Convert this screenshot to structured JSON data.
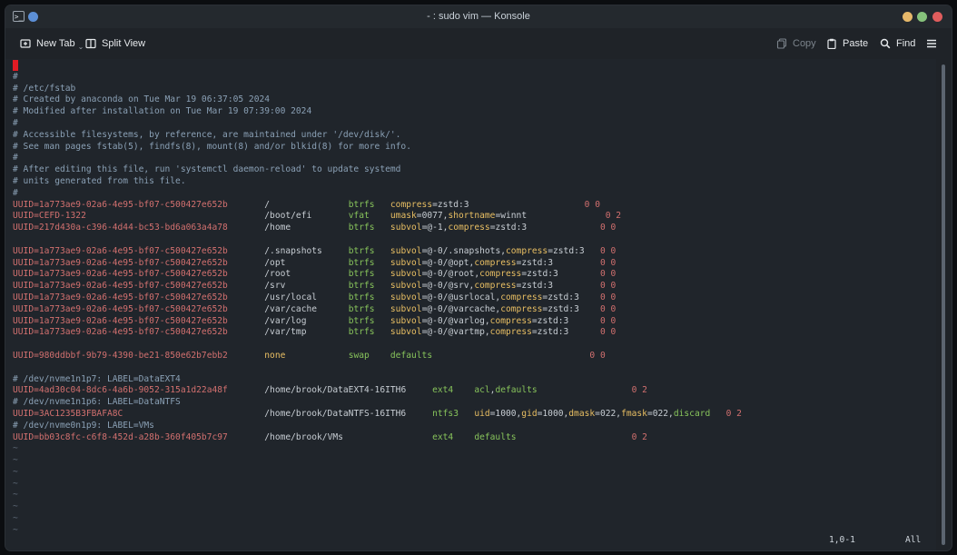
{
  "window": {
    "title": "- : sudo vim — Konsole",
    "app_icon": "terminal-icon",
    "controls": [
      "minimize-icon",
      "maximize-icon",
      "close-icon"
    ]
  },
  "toolbar": {
    "new_tab": "New Tab",
    "split_view": "Split View",
    "copy": "Copy",
    "paste": "Paste",
    "find": "Find"
  },
  "editor": {
    "lines": [
      [
        {
          "t": "",
          "c": "cursor"
        }
      ],
      [
        {
          "t": "#",
          "c": "cmt"
        }
      ],
      [
        {
          "t": "# /etc/fstab",
          "c": "cmt"
        }
      ],
      [
        {
          "t": "# Created by anaconda on Tue Mar 19 06:37:05 2024",
          "c": "cmt"
        }
      ],
      [
        {
          "t": "# Modified after installation on Tue Mar 19 07:39:00 2024",
          "c": "cmt"
        }
      ],
      [
        {
          "t": "#",
          "c": "cmt"
        }
      ],
      [
        {
          "t": "# Accessible filesystems, by reference, are maintained under '/dev/disk/'.",
          "c": "cmt"
        }
      ],
      [
        {
          "t": "# See man pages fstab(5), findfs(8), mount(8) and/or blkid(8) for more info.",
          "c": "cmt"
        }
      ],
      [
        {
          "t": "#",
          "c": "cmt"
        }
      ],
      [
        {
          "t": "# After editing this file, run 'systemctl daemon-reload' to update systemd",
          "c": "cmt"
        }
      ],
      [
        {
          "t": "# units generated from this file.",
          "c": "cmt"
        }
      ],
      [
        {
          "t": "#",
          "c": "cmt"
        }
      ],
      [
        {
          "t": "UUID=1a773ae9-02a6-4e95-bf07-c500427e652b",
          "c": "uuid"
        },
        {
          "t": "       ",
          "c": "val"
        },
        {
          "t": "/",
          "c": "path"
        },
        {
          "t": "               ",
          "c": "val"
        },
        {
          "t": "btrfs",
          "c": "fs"
        },
        {
          "t": "   ",
          "c": "val"
        },
        {
          "t": "compress",
          "c": "key"
        },
        {
          "t": "=zstd:3",
          "c": "val"
        },
        {
          "t": "                      ",
          "c": "val"
        },
        {
          "t": "0 0",
          "c": "num"
        }
      ],
      [
        {
          "t": "UUID=CEFD-1322",
          "c": "uuid"
        },
        {
          "t": "                                  ",
          "c": "val"
        },
        {
          "t": "/boot/efi",
          "c": "path"
        },
        {
          "t": "       ",
          "c": "val"
        },
        {
          "t": "vfat",
          "c": "fs"
        },
        {
          "t": "    ",
          "c": "val"
        },
        {
          "t": "umask",
          "c": "key"
        },
        {
          "t": "=0077,",
          "c": "val"
        },
        {
          "t": "shortname",
          "c": "key"
        },
        {
          "t": "=winnt",
          "c": "val"
        },
        {
          "t": "               ",
          "c": "val"
        },
        {
          "t": "0 2",
          "c": "num"
        }
      ],
      [
        {
          "t": "UUID=217d430a-c396-4d44-bc53-bd6a063a4a78",
          "c": "uuid"
        },
        {
          "t": "       ",
          "c": "val"
        },
        {
          "t": "/home",
          "c": "path"
        },
        {
          "t": "           ",
          "c": "val"
        },
        {
          "t": "btrfs",
          "c": "fs"
        },
        {
          "t": "   ",
          "c": "val"
        },
        {
          "t": "subvol",
          "c": "key"
        },
        {
          "t": "=@-1,",
          "c": "val"
        },
        {
          "t": "compress",
          "c": "key"
        },
        {
          "t": "=zstd:3",
          "c": "val"
        },
        {
          "t": "              ",
          "c": "val"
        },
        {
          "t": "0 0",
          "c": "num"
        }
      ],
      [
        {
          "t": "",
          "c": "val"
        }
      ],
      [
        {
          "t": "UUID=1a773ae9-02a6-4e95-bf07-c500427e652b",
          "c": "uuid"
        },
        {
          "t": "       ",
          "c": "val"
        },
        {
          "t": "/.snapshots",
          "c": "path"
        },
        {
          "t": "     ",
          "c": "val"
        },
        {
          "t": "btrfs",
          "c": "fs"
        },
        {
          "t": "   ",
          "c": "val"
        },
        {
          "t": "subvol",
          "c": "key"
        },
        {
          "t": "=@-0/.snapshots,",
          "c": "val"
        },
        {
          "t": "compress",
          "c": "key"
        },
        {
          "t": "=zstd:3",
          "c": "val"
        },
        {
          "t": "   ",
          "c": "val"
        },
        {
          "t": "0 0",
          "c": "num"
        }
      ],
      [
        {
          "t": "UUID=1a773ae9-02a6-4e95-bf07-c500427e652b",
          "c": "uuid"
        },
        {
          "t": "       ",
          "c": "val"
        },
        {
          "t": "/opt",
          "c": "path"
        },
        {
          "t": "            ",
          "c": "val"
        },
        {
          "t": "btrfs",
          "c": "fs"
        },
        {
          "t": "   ",
          "c": "val"
        },
        {
          "t": "subvol",
          "c": "key"
        },
        {
          "t": "=@-0/@opt,",
          "c": "val"
        },
        {
          "t": "compress",
          "c": "key"
        },
        {
          "t": "=zstd:3",
          "c": "val"
        },
        {
          "t": "         ",
          "c": "val"
        },
        {
          "t": "0 0",
          "c": "num"
        }
      ],
      [
        {
          "t": "UUID=1a773ae9-02a6-4e95-bf07-c500427e652b",
          "c": "uuid"
        },
        {
          "t": "       ",
          "c": "val"
        },
        {
          "t": "/root",
          "c": "path"
        },
        {
          "t": "           ",
          "c": "val"
        },
        {
          "t": "btrfs",
          "c": "fs"
        },
        {
          "t": "   ",
          "c": "val"
        },
        {
          "t": "subvol",
          "c": "key"
        },
        {
          "t": "=@-0/@root,",
          "c": "val"
        },
        {
          "t": "compress",
          "c": "key"
        },
        {
          "t": "=zstd:3",
          "c": "val"
        },
        {
          "t": "        ",
          "c": "val"
        },
        {
          "t": "0 0",
          "c": "num"
        }
      ],
      [
        {
          "t": "UUID=1a773ae9-02a6-4e95-bf07-c500427e652b",
          "c": "uuid"
        },
        {
          "t": "       ",
          "c": "val"
        },
        {
          "t": "/srv",
          "c": "path"
        },
        {
          "t": "            ",
          "c": "val"
        },
        {
          "t": "btrfs",
          "c": "fs"
        },
        {
          "t": "   ",
          "c": "val"
        },
        {
          "t": "subvol",
          "c": "key"
        },
        {
          "t": "=@-0/@srv,",
          "c": "val"
        },
        {
          "t": "compress",
          "c": "key"
        },
        {
          "t": "=zstd:3",
          "c": "val"
        },
        {
          "t": "         ",
          "c": "val"
        },
        {
          "t": "0 0",
          "c": "num"
        }
      ],
      [
        {
          "t": "UUID=1a773ae9-02a6-4e95-bf07-c500427e652b",
          "c": "uuid"
        },
        {
          "t": "       ",
          "c": "val"
        },
        {
          "t": "/usr/local",
          "c": "path"
        },
        {
          "t": "      ",
          "c": "val"
        },
        {
          "t": "btrfs",
          "c": "fs"
        },
        {
          "t": "   ",
          "c": "val"
        },
        {
          "t": "subvol",
          "c": "key"
        },
        {
          "t": "=@-0/@usrlocal,",
          "c": "val"
        },
        {
          "t": "compress",
          "c": "key"
        },
        {
          "t": "=zstd:3",
          "c": "val"
        },
        {
          "t": "    ",
          "c": "val"
        },
        {
          "t": "0 0",
          "c": "num"
        }
      ],
      [
        {
          "t": "UUID=1a773ae9-02a6-4e95-bf07-c500427e652b",
          "c": "uuid"
        },
        {
          "t": "       ",
          "c": "val"
        },
        {
          "t": "/var/cache",
          "c": "path"
        },
        {
          "t": "      ",
          "c": "val"
        },
        {
          "t": "btrfs",
          "c": "fs"
        },
        {
          "t": "   ",
          "c": "val"
        },
        {
          "t": "subvol",
          "c": "key"
        },
        {
          "t": "=@-0/@varcache,",
          "c": "val"
        },
        {
          "t": "compress",
          "c": "key"
        },
        {
          "t": "=zstd:3",
          "c": "val"
        },
        {
          "t": "    ",
          "c": "val"
        },
        {
          "t": "0 0",
          "c": "num"
        }
      ],
      [
        {
          "t": "UUID=1a773ae9-02a6-4e95-bf07-c500427e652b",
          "c": "uuid"
        },
        {
          "t": "       ",
          "c": "val"
        },
        {
          "t": "/var/log",
          "c": "path"
        },
        {
          "t": "        ",
          "c": "val"
        },
        {
          "t": "btrfs",
          "c": "fs"
        },
        {
          "t": "   ",
          "c": "val"
        },
        {
          "t": "subvol",
          "c": "key"
        },
        {
          "t": "=@-0/@varlog,",
          "c": "val"
        },
        {
          "t": "compress",
          "c": "key"
        },
        {
          "t": "=zstd:3",
          "c": "val"
        },
        {
          "t": "      ",
          "c": "val"
        },
        {
          "t": "0 0",
          "c": "num"
        }
      ],
      [
        {
          "t": "UUID=1a773ae9-02a6-4e95-bf07-c500427e652b",
          "c": "uuid"
        },
        {
          "t": "       ",
          "c": "val"
        },
        {
          "t": "/var/tmp",
          "c": "path"
        },
        {
          "t": "        ",
          "c": "val"
        },
        {
          "t": "btrfs",
          "c": "fs"
        },
        {
          "t": "   ",
          "c": "val"
        },
        {
          "t": "subvol",
          "c": "key"
        },
        {
          "t": "=@-0/@vartmp,",
          "c": "val"
        },
        {
          "t": "compress",
          "c": "key"
        },
        {
          "t": "=zstd:3",
          "c": "val"
        },
        {
          "t": "      ",
          "c": "val"
        },
        {
          "t": "0 0",
          "c": "num"
        }
      ],
      [
        {
          "t": "",
          "c": "val"
        }
      ],
      [
        {
          "t": "UUID=980ddbbf-9b79-4390-be21-850e62b7ebb2",
          "c": "uuid"
        },
        {
          "t": "       ",
          "c": "val"
        },
        {
          "t": "none",
          "c": "none"
        },
        {
          "t": "            ",
          "c": "val"
        },
        {
          "t": "swap",
          "c": "fs"
        },
        {
          "t": "    ",
          "c": "val"
        },
        {
          "t": "defaults",
          "c": "fs"
        },
        {
          "t": "                              ",
          "c": "val"
        },
        {
          "t": "0 0",
          "c": "num"
        }
      ],
      [
        {
          "t": "",
          "c": "val"
        }
      ],
      [
        {
          "t": "# /dev/nvme1n1p7: LABEL=DataEXT4",
          "c": "cmt"
        }
      ],
      [
        {
          "t": "UUID=4ad30c04-8dc6-4a6b-9052-315a1d22a48f",
          "c": "uuid"
        },
        {
          "t": "       ",
          "c": "val"
        },
        {
          "t": "/home/brook/DataEXT4-16ITH6",
          "c": "path"
        },
        {
          "t": "     ",
          "c": "val"
        },
        {
          "t": "ext4",
          "c": "fs"
        },
        {
          "t": "    ",
          "c": "val"
        },
        {
          "t": "acl",
          "c": "fs"
        },
        {
          "t": ",",
          "c": "val"
        },
        {
          "t": "defaults",
          "c": "fs"
        },
        {
          "t": "                  ",
          "c": "val"
        },
        {
          "t": "0 2",
          "c": "num"
        }
      ],
      [
        {
          "t": "# /dev/nvme1n1p6: LABEL=DataNTFS",
          "c": "cmt"
        }
      ],
      [
        {
          "t": "UUID=3AC1235B3FBAFA8C",
          "c": "uuid"
        },
        {
          "t": "                           ",
          "c": "val"
        },
        {
          "t": "/home/brook/DataNTFS-16ITH6",
          "c": "path"
        },
        {
          "t": "     ",
          "c": "val"
        },
        {
          "t": "ntfs3",
          "c": "fs"
        },
        {
          "t": "   ",
          "c": "val"
        },
        {
          "t": "uid",
          "c": "key"
        },
        {
          "t": "=1000,",
          "c": "val"
        },
        {
          "t": "gid",
          "c": "key"
        },
        {
          "t": "=1000,",
          "c": "val"
        },
        {
          "t": "dmask",
          "c": "key"
        },
        {
          "t": "=022,",
          "c": "val"
        },
        {
          "t": "fmask",
          "c": "key"
        },
        {
          "t": "=022,",
          "c": "val"
        },
        {
          "t": "discard",
          "c": "fs"
        },
        {
          "t": "   ",
          "c": "val"
        },
        {
          "t": "0 2",
          "c": "num"
        }
      ],
      [
        {
          "t": "# /dev/nvme0n1p9: LABEL=VMs",
          "c": "cmt"
        }
      ],
      [
        {
          "t": "UUID=bb03c8fc-c6f8-452d-a28b-360f405b7c97",
          "c": "uuid"
        },
        {
          "t": "       ",
          "c": "val"
        },
        {
          "t": "/home/brook/VMs",
          "c": "path"
        },
        {
          "t": "                 ",
          "c": "val"
        },
        {
          "t": "ext4",
          "c": "fs"
        },
        {
          "t": "    ",
          "c": "val"
        },
        {
          "t": "defaults",
          "c": "fs"
        },
        {
          "t": "                      ",
          "c": "val"
        },
        {
          "t": "0 2",
          "c": "num"
        }
      ],
      [
        {
          "t": "~",
          "c": "tilde"
        }
      ],
      [
        {
          "t": "~",
          "c": "tilde"
        }
      ],
      [
        {
          "t": "~",
          "c": "tilde"
        }
      ],
      [
        {
          "t": "~",
          "c": "tilde"
        }
      ],
      [
        {
          "t": "~",
          "c": "tilde"
        }
      ],
      [
        {
          "t": "~",
          "c": "tilde"
        }
      ],
      [
        {
          "t": "~",
          "c": "tilde"
        }
      ],
      [
        {
          "t": "~",
          "c": "tilde"
        }
      ]
    ],
    "status_position": "1,0-1",
    "status_scroll": "All"
  },
  "colors": {
    "comment": "#8aa0b5",
    "uuid": "#d2706f",
    "fstype": "#87c35b",
    "option_key": "#e9bf63",
    "cursor": "#e01b24",
    "background": "#20252b"
  }
}
